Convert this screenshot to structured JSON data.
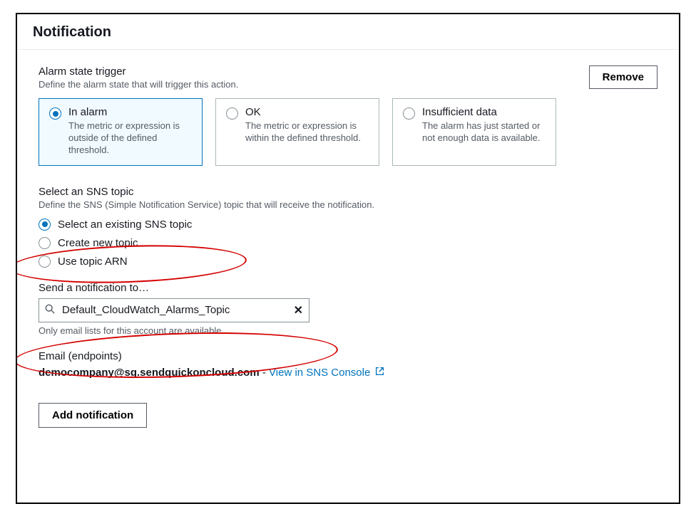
{
  "header": {
    "title": "Notification"
  },
  "remove_label": "Remove",
  "trigger": {
    "title": "Alarm state trigger",
    "desc": "Define the alarm state that will trigger this action.",
    "options": [
      {
        "title": "In alarm",
        "desc": "The metric or expression is outside of the defined threshold.",
        "selected": true
      },
      {
        "title": "OK",
        "desc": "The metric or expression is within the defined threshold.",
        "selected": false
      },
      {
        "title": "Insufficient data",
        "desc": "The alarm has just started or not enough data is available.",
        "selected": false
      }
    ]
  },
  "sns": {
    "title": "Select an SNS topic",
    "desc": "Define the SNS (Simple Notification Service) topic that will receive the notification.",
    "options": [
      {
        "label": "Select an existing SNS topic",
        "selected": true
      },
      {
        "label": "Create new topic",
        "selected": false
      },
      {
        "label": "Use topic ARN",
        "selected": false
      }
    ]
  },
  "send": {
    "title": "Send a notification to…",
    "value": "Default_CloudWatch_Alarms_Topic",
    "hint": "Only email lists for this account are available."
  },
  "endpoints": {
    "title": "Email (endpoints)",
    "email": "democompany@sg.sendquickoncloud.com",
    "dash": " - ",
    "link": "View in SNS Console"
  },
  "add_label": "Add notification"
}
